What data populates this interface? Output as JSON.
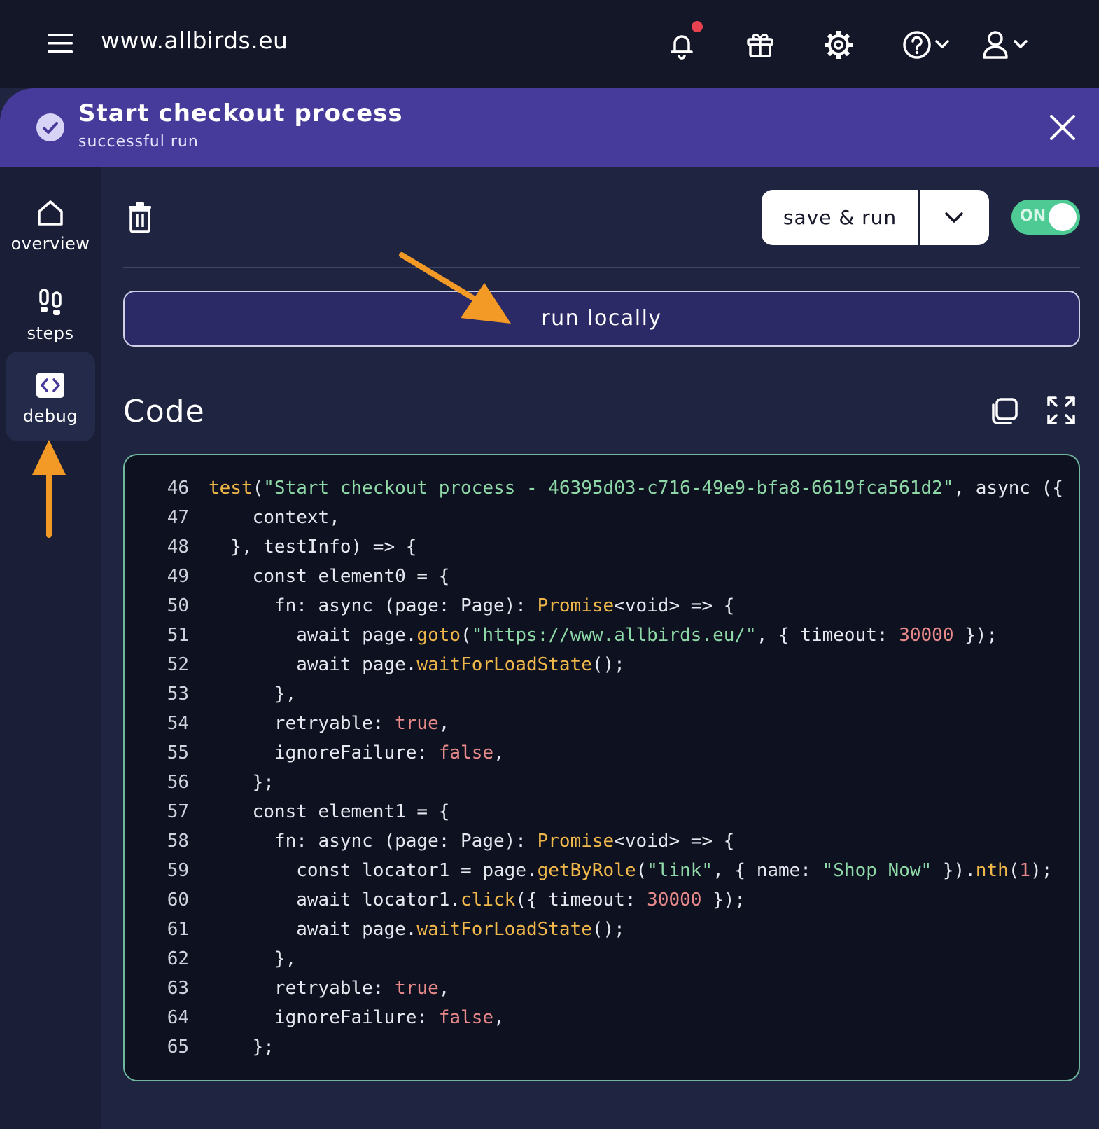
{
  "topbar": {
    "site": "www.allbirds.eu",
    "icons": [
      "menu-icon",
      "bell-icon",
      "gift-icon",
      "gear-icon",
      "help-icon",
      "user-icon"
    ]
  },
  "banner": {
    "title": "Start checkout process",
    "subtitle": "successful run"
  },
  "sidebar": {
    "items": [
      {
        "label": "overview",
        "icon": "home-icon"
      },
      {
        "label": "steps",
        "icon": "footsteps-icon"
      },
      {
        "label": "debug",
        "icon": "code-icon",
        "active": true
      }
    ]
  },
  "toolbar": {
    "save_run_label": "save & run",
    "toggle_label": "ON"
  },
  "run_locally_label": "run locally",
  "code": {
    "title": "Code",
    "lines": [
      {
        "n": "46",
        "html": "<span class=\"fn\">test</span>(<span class=\"str\">\"Start checkout process - 46395d03-c716-49e9-bfa8-6619fca561d2\"</span>, async ({"
      },
      {
        "n": "47",
        "html": "    context,"
      },
      {
        "n": "48",
        "html": "  }, testInfo) => {"
      },
      {
        "n": "49",
        "html": "    const element0 = {"
      },
      {
        "n": "50",
        "html": "      fn: async (page: Page): <span class=\"fn\">Promise</span>&lt;void&gt; => {"
      },
      {
        "n": "51",
        "html": "        await page.<span class=\"fn\">goto</span>(<span class=\"str\">\"https://www.allbirds.eu/\"</span>, { timeout: <span class=\"num\">30000</span> });"
      },
      {
        "n": "52",
        "html": "        await page.<span class=\"fn\">waitForLoadState</span>();"
      },
      {
        "n": "53",
        "html": "      },"
      },
      {
        "n": "54",
        "html": "      retryable: <span class=\"bool\">true</span>,"
      },
      {
        "n": "55",
        "html": "      ignoreFailure: <span class=\"bool\">false</span>,"
      },
      {
        "n": "56",
        "html": "    };"
      },
      {
        "n": "57",
        "html": "    const element1 = {"
      },
      {
        "n": "58",
        "html": "      fn: async (page: Page): <span class=\"fn\">Promise</span>&lt;void&gt; => {"
      },
      {
        "n": "59",
        "html": "        const locator1 = page.<span class=\"fn\">getByRole</span>(<span class=\"str\">\"link\"</span>, { name: <span class=\"str\">\"Shop Now\"</span> }).<span class=\"fn\">nth</span>(<span class=\"num\">1</span>);"
      },
      {
        "n": "60",
        "html": "        await locator1.<span class=\"fn\">click</span>({ timeout: <span class=\"num\">30000</span> });"
      },
      {
        "n": "61",
        "html": "        await page.<span class=\"fn\">waitForLoadState</span>();"
      },
      {
        "n": "62",
        "html": "      },"
      },
      {
        "n": "63",
        "html": "      retryable: <span class=\"bool\">true</span>,"
      },
      {
        "n": "64",
        "html": "      ignoreFailure: <span class=\"bool\">false</span>,"
      },
      {
        "n": "65",
        "html": "    };"
      }
    ]
  },
  "colors": {
    "accent": "#463b9a",
    "toggle_on": "#4ecb94",
    "annotation_arrow": "#f39a26"
  }
}
